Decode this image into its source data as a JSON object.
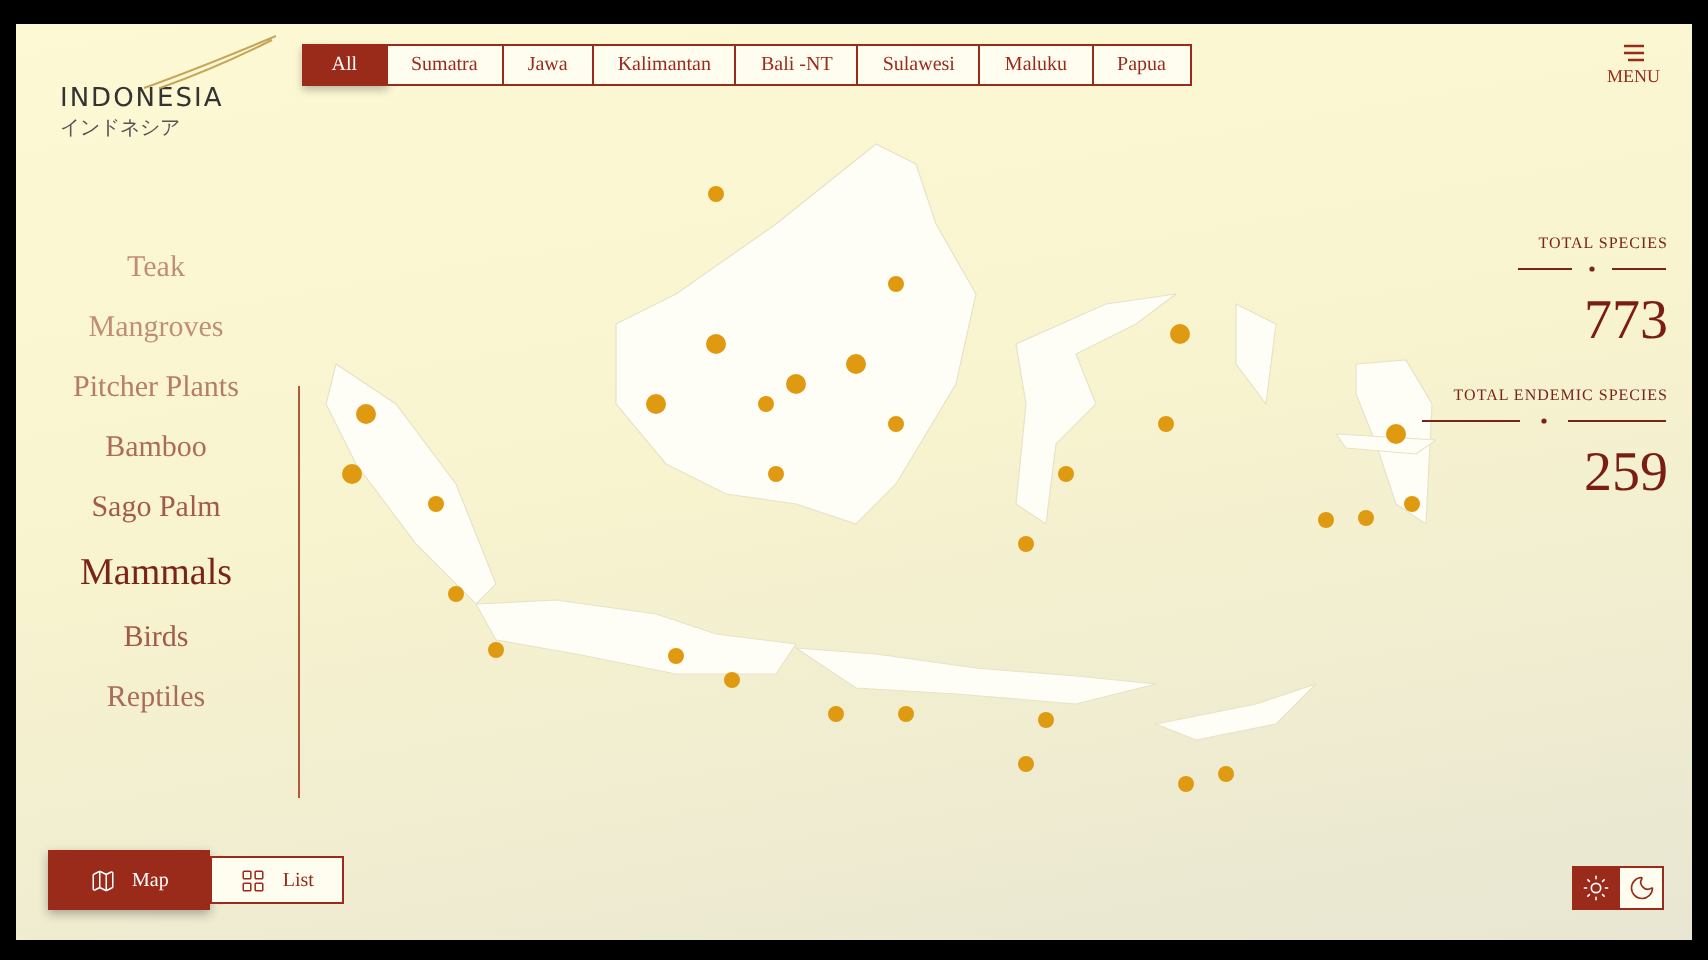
{
  "logo": {
    "name": "INDONESIA",
    "subtitle": "インドネシア"
  },
  "region_tabs": [
    {
      "label": "All",
      "selected": true
    },
    {
      "label": "Sumatra",
      "selected": false
    },
    {
      "label": "Jawa",
      "selected": false
    },
    {
      "label": "Kalimantan",
      "selected": false
    },
    {
      "label": "Bali -NT",
      "selected": false
    },
    {
      "label": "Sulawesi",
      "selected": false
    },
    {
      "label": "Maluku",
      "selected": false
    },
    {
      "label": "Papua",
      "selected": false
    }
  ],
  "menu": {
    "label": "MENU"
  },
  "categories": [
    {
      "label": "Teak",
      "selected": false
    },
    {
      "label": "Mangroves",
      "selected": false
    },
    {
      "label": "Pitcher Plants",
      "selected": false
    },
    {
      "label": "Bamboo",
      "selected": false
    },
    {
      "label": "Sago Palm",
      "selected": false
    },
    {
      "label": "Mammals",
      "selected": true
    },
    {
      "label": "Birds",
      "selected": false
    },
    {
      "label": "Reptiles",
      "selected": false
    }
  ],
  "stats": [
    {
      "label": "TOTAL SPECIES",
      "value": "773"
    },
    {
      "label": "TOTAL ENDEMIC SPECIES",
      "value": "259"
    }
  ],
  "view_toggle": [
    {
      "label": "Map",
      "kind": "map",
      "selected": true
    },
    {
      "label": "List",
      "kind": "grid",
      "selected": false
    }
  ],
  "theme_toggle": [
    {
      "kind": "sun",
      "selected": true
    },
    {
      "kind": "moon",
      "selected": false
    }
  ]
}
